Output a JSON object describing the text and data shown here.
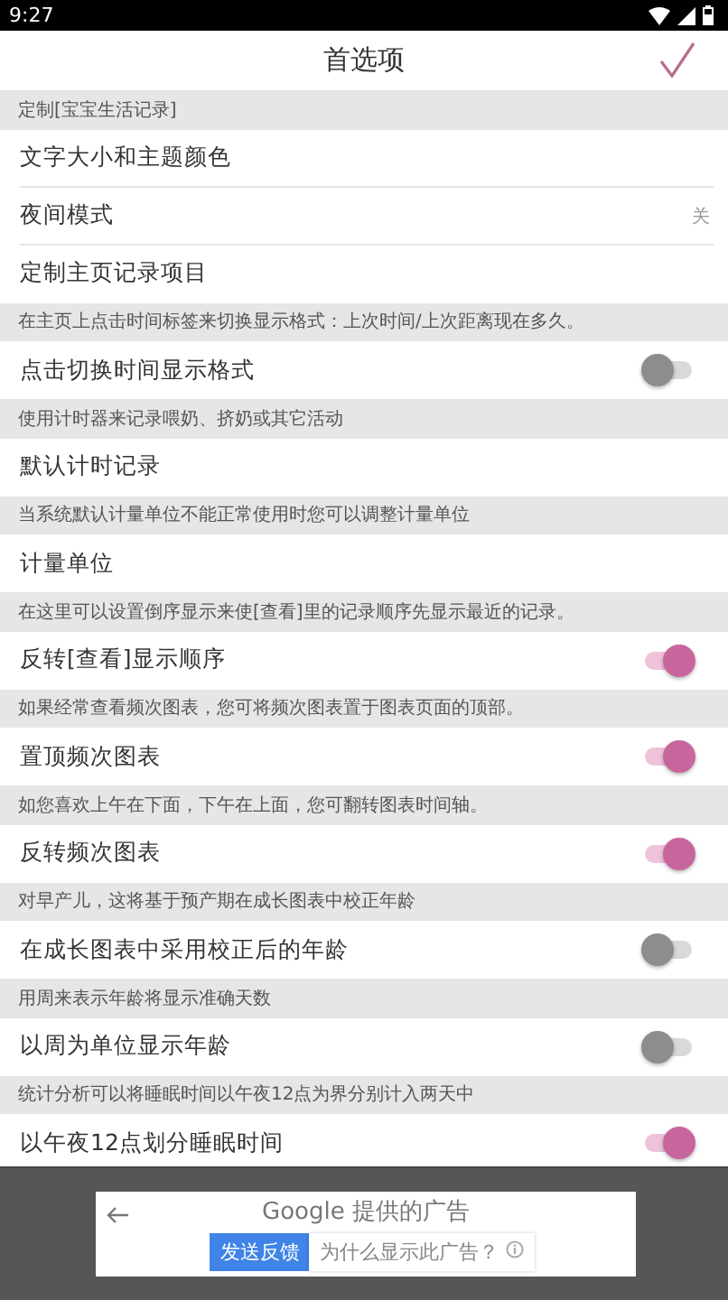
{
  "status_bar": {
    "time": "9:27"
  },
  "header": {
    "title": "首选项"
  },
  "sections": [
    {
      "description": "定制[宝宝生活记录]",
      "items": [
        {
          "kind": "link",
          "label": "文字大小和主题颜色"
        },
        {
          "kind": "value",
          "label": "夜间模式",
          "value": "关"
        },
        {
          "kind": "link",
          "label": "定制主页记录项目"
        }
      ]
    },
    {
      "description": "在主页上点击时间标签来切换显示格式：上次时间/上次距离现在多久。",
      "items": [
        {
          "kind": "switch",
          "label": "点击切换时间显示格式",
          "on": false
        }
      ]
    },
    {
      "description": "使用计时器来记录喂奶、挤奶或其它活动",
      "items": [
        {
          "kind": "link",
          "label": "默认计时记录"
        }
      ]
    },
    {
      "description": "当系统默认计量单位不能正常使用时您可以调整计量单位",
      "items": [
        {
          "kind": "link",
          "label": "计量单位"
        }
      ]
    },
    {
      "description": "在这里可以设置倒序显示来使[查看]里的记录顺序先显示最近的记录。",
      "items": [
        {
          "kind": "switch",
          "label": "反转[查看]显示顺序",
          "on": true
        }
      ]
    },
    {
      "description": "如果经常查看频次图表，您可将频次图表置于图表页面的顶部。",
      "items": [
        {
          "kind": "switch",
          "label": "置顶频次图表",
          "on": true
        }
      ]
    },
    {
      "description": "如您喜欢上午在下面，下午在上面，您可翻转图表时间轴。",
      "items": [
        {
          "kind": "switch",
          "label": "反转频次图表",
          "on": true
        }
      ]
    },
    {
      "description": "对早产儿，这将基于预产期在成长图表中校正年龄",
      "items": [
        {
          "kind": "switch",
          "label": "在成长图表中采用校正后的年龄",
          "on": false
        }
      ]
    },
    {
      "description": "用周来表示年龄将显示准确天数",
      "items": [
        {
          "kind": "switch",
          "label": "以周为单位显示年龄",
          "on": false
        }
      ]
    },
    {
      "description": "统计分析可以将睡眠时间以午夜12点为界分别计入两天中",
      "items": [
        {
          "kind": "switch",
          "label": "以午夜12点划分睡眠时间",
          "on": true
        }
      ]
    }
  ],
  "ad": {
    "title": "Google 提供的广告",
    "feedback_button": "发送反馈",
    "why_link": "为什么显示此广告？"
  }
}
